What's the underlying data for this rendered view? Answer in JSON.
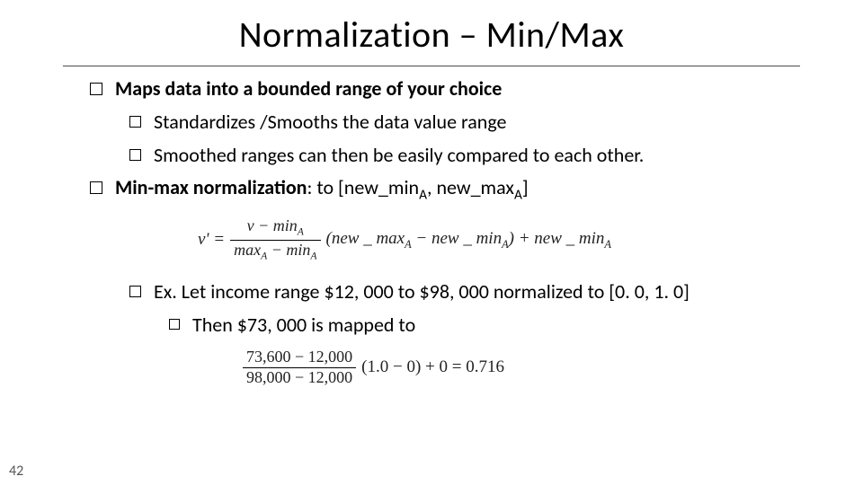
{
  "title": "Normalization – Min/Max",
  "points": {
    "p1": "Maps data into a bounded range of your choice",
    "p1a": "Standardizes /Smooths the data value range",
    "p1b": "Smoothed ranges can then be easily compared to each other.",
    "p2_pre": "Min-max normalization",
    "p2_post": ": to [new_min",
    "p2_sub1": "A",
    "p2_mid": ", new_max",
    "p2_sub2": "A",
    "p2_end": "]",
    "ex": "Ex.  Let income range $12, 000 to $98, 000 normalized to [0. 0, 1. 0]",
    "ex_then": "Then $73, 000 is mapped to"
  },
  "formula1": {
    "lhs": "v' =",
    "num1": "v − min",
    "den1_a": "max",
    "den1_b": " − min",
    "subA": "A",
    "paren_a": "(new _ max",
    "paren_b": " − new _ min",
    "paren_c": ") + new _ min"
  },
  "formula2": {
    "num": "73,600 − 12,000",
    "den": "98,000 − 12,000",
    "tail": "(1.0 − 0) + 0 = 0.716"
  },
  "page": "42"
}
